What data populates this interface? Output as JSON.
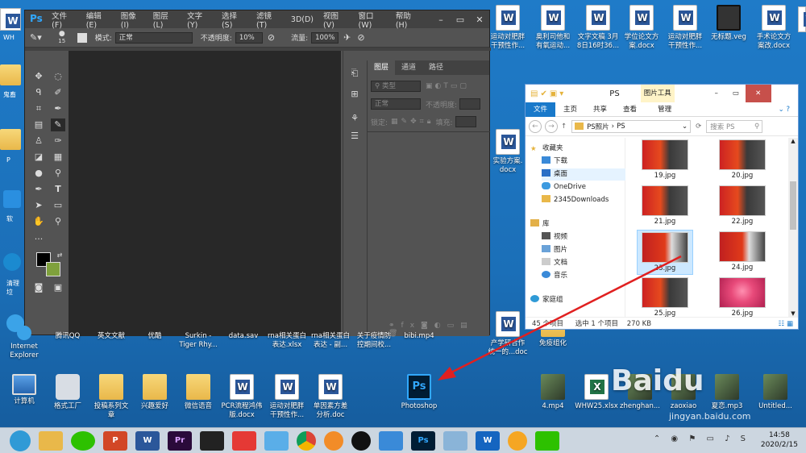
{
  "desktop": {
    "top_row": [
      {
        "label": "运动对肥胖\n干预性作...",
        "type": "docw"
      },
      {
        "label": "奥利司他和\n有氧运动...",
        "type": "docw"
      },
      {
        "label": "文字文稿 3月\n8日16时36...",
        "type": "docw"
      },
      {
        "label": "学位论文方\n案.docx",
        "type": "docw"
      },
      {
        "label": "运动对肥胖\n干预性作...",
        "type": "docw"
      },
      {
        "label": "无标题.veg",
        "type": "video"
      },
      {
        "label": "手术论文方\n案改.docx",
        "type": "docw"
      }
    ],
    "right_side": [
      {
        "label": "实验方案.\ndocx"
      },
      {
        "label": "产学研合作\n统一的...doc"
      },
      {
        "label": "免疫组化"
      }
    ],
    "mid_row": [
      {
        "label": "Internet\nExplorer"
      },
      {
        "label": "腾讯QQ"
      },
      {
        "label": "英文文献"
      },
      {
        "label": "优酷"
      },
      {
        "label": "Surkin -\nTiger Rhy..."
      },
      {
        "label": "data.sav"
      },
      {
        "label": "rna相关蛋白\n表达.xlsx"
      },
      {
        "label": "rna相关蛋白\n表达 - 副..."
      },
      {
        "label": "关于疫情防\n控期间校..."
      },
      {
        "label": "bibi.mp4"
      }
    ],
    "bottom_row": [
      {
        "label": "计算机"
      },
      {
        "label": "格式工厂"
      },
      {
        "label": "投稿系列文\n章"
      },
      {
        "label": "兴趣爱好"
      },
      {
        "label": "微信语音"
      },
      {
        "label": "PCR流程鸿伟\n版.docx"
      },
      {
        "label": "运动对肥胖\n干预性作..."
      },
      {
        "label": "单因素方差\n分析.doc"
      },
      {
        "label": "Photoshop"
      }
    ],
    "bottom_right": [
      {
        "label": "4.mp4"
      },
      {
        "label": "WHW25.xlsx"
      },
      {
        "label": "zhenghan..."
      },
      {
        "label": "zaoxiao"
      },
      {
        "label": "夏恋.mp3"
      },
      {
        "label": "Untitled..."
      }
    ],
    "left_edge": [
      {
        "label": "WH"
      },
      {
        "label": "鬼畜"
      },
      {
        "label": "P"
      },
      {
        "label": "软"
      },
      {
        "label": "清理垃"
      }
    ]
  },
  "photoshop": {
    "logo": "Ps",
    "menu": [
      "文件(F)",
      "编辑(E)",
      "图像(I)",
      "图层(L)",
      "文字(Y)",
      "选择(S)",
      "滤镜(T)",
      "3D(D)",
      "视图(V)",
      "窗口(W)",
      "帮助(H)"
    ],
    "options": {
      "brush_size": "15",
      "mode_label": "模式:",
      "mode_value": "正常",
      "opacity_label": "不透明度:",
      "opacity_value": "10%",
      "flow_label": "流量:",
      "flow_value": "100%"
    },
    "panel": {
      "tabs": [
        "图层",
        "通道",
        "路径"
      ],
      "kind_label": "类型",
      "blend_value": "正常",
      "opacity_label": "不透明度:",
      "lock_label": "锁定:",
      "fill_label": "填充:"
    }
  },
  "explorer": {
    "title": "PS",
    "picture_tools": "图片工具",
    "ribbon": [
      "文件",
      "主页",
      "共享",
      "查看",
      "管理"
    ],
    "path": [
      "PS照片",
      "PS"
    ],
    "search_placeholder": "搜索 PS",
    "tree": [
      {
        "label": "收藏夹",
        "indent": 0
      },
      {
        "label": "下载",
        "indent": 1
      },
      {
        "label": "桌面",
        "indent": 1
      },
      {
        "label": "OneDrive",
        "indent": 1
      },
      {
        "label": "2345Downloads",
        "indent": 1
      },
      {
        "label": "库",
        "indent": 0
      },
      {
        "label": "视频",
        "indent": 1
      },
      {
        "label": "图片",
        "indent": 1
      },
      {
        "label": "文档",
        "indent": 1
      },
      {
        "label": "音乐",
        "indent": 1
      },
      {
        "label": "家庭组",
        "indent": 0
      }
    ],
    "files": [
      "19.jpg",
      "20.jpg",
      "21.jpg",
      "22.jpg",
      "23.jpg",
      "24.jpg",
      "25.jpg",
      "26.jpg"
    ],
    "status_count": "45 个项目",
    "status_selected": "选中 1 个项目",
    "status_size": "270 KB"
  },
  "taskbar": {
    "time": "14:58",
    "date": "2020/2/15"
  },
  "watermark": {
    "logo": "Baidu",
    "url": "jingyan.baidu.com"
  }
}
